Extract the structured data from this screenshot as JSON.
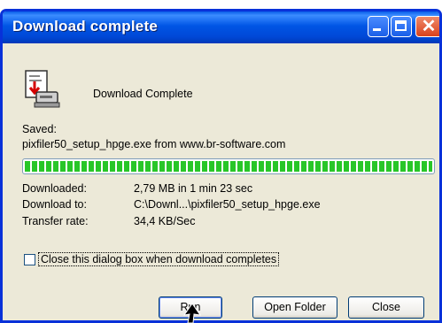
{
  "window": {
    "title": "Download complete"
  },
  "titlebar_buttons": {
    "minimize_icon": "minimize-icon",
    "maximize_icon": "maximize-icon",
    "close_glyph": "✕"
  },
  "header": {
    "heading": "Download Complete",
    "icon": "download-document-icon"
  },
  "details": {
    "saved_label": "Saved:",
    "saved_value": "pixfiler50_setup_hpge.exe from www.br-software.com",
    "progress_fraction": 1.0,
    "downloaded_label": "Downloaded:",
    "downloaded_value": "2,79 MB in 1 min 23 sec",
    "download_to_label": "Download to:",
    "download_to_value": "C:\\Downl...\\pixfiler50_setup_hpge.exe",
    "transfer_rate_label": "Transfer rate:",
    "transfer_rate_value": "34,4 KB/Sec"
  },
  "options": {
    "close_when_complete_label": "Close this dialog box when download completes",
    "close_when_complete_checked": false
  },
  "buttons": {
    "run_label": "Run",
    "open_folder_label": "Open Folder",
    "close_label": "Close"
  },
  "colors": {
    "titlebar_blue": "#0055e5",
    "progress_green": "#28c628",
    "dialog_bg": "#ece9d8"
  }
}
